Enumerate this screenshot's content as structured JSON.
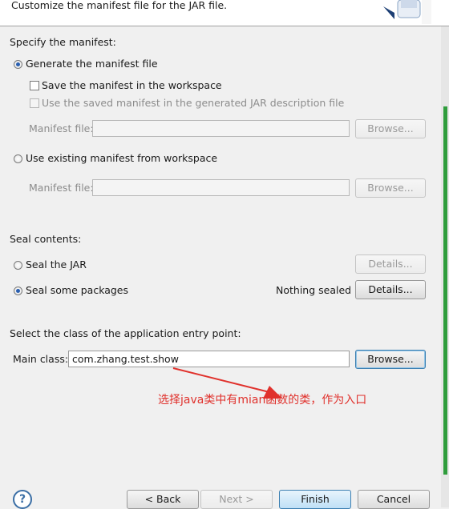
{
  "header": {
    "title": "Customize the manifest file for the JAR file.",
    "icon": "jar-wizard-icon"
  },
  "manifest": {
    "section_title": "Specify the manifest:",
    "generate_label": "Generate the manifest file",
    "generate_selected": true,
    "save_label": "Save the manifest in the workspace",
    "save_checked": false,
    "use_saved_label": "Use the saved manifest in the generated JAR description file",
    "use_saved_checked": false,
    "file_label_1": "Manifest file:",
    "file_value_1": "",
    "browse_1": "Browse...",
    "existing_label": "Use existing manifest from workspace",
    "existing_selected": false,
    "file_label_2": "Manifest file:",
    "file_value_2": "",
    "browse_2": "Browse..."
  },
  "seal": {
    "section_title": "Seal contents:",
    "seal_jar_label": "Seal the JAR",
    "seal_jar_selected": false,
    "details_1": "Details...",
    "seal_some_label": "Seal some packages",
    "seal_some_selected": true,
    "status": "Nothing sealed",
    "details_2": "Details..."
  },
  "entry": {
    "section_title": "Select the class of the application entry point:",
    "main_label": "Main class:",
    "main_value": "com.zhang.test.show",
    "browse": "Browse..."
  },
  "annotation": {
    "text": "选择java类中有mian函数的类，作为入口",
    "color": "#e0312c"
  },
  "footer": {
    "help": "?",
    "back": "< Back",
    "next": "Next >",
    "finish": "Finish",
    "cancel": "Cancel"
  }
}
